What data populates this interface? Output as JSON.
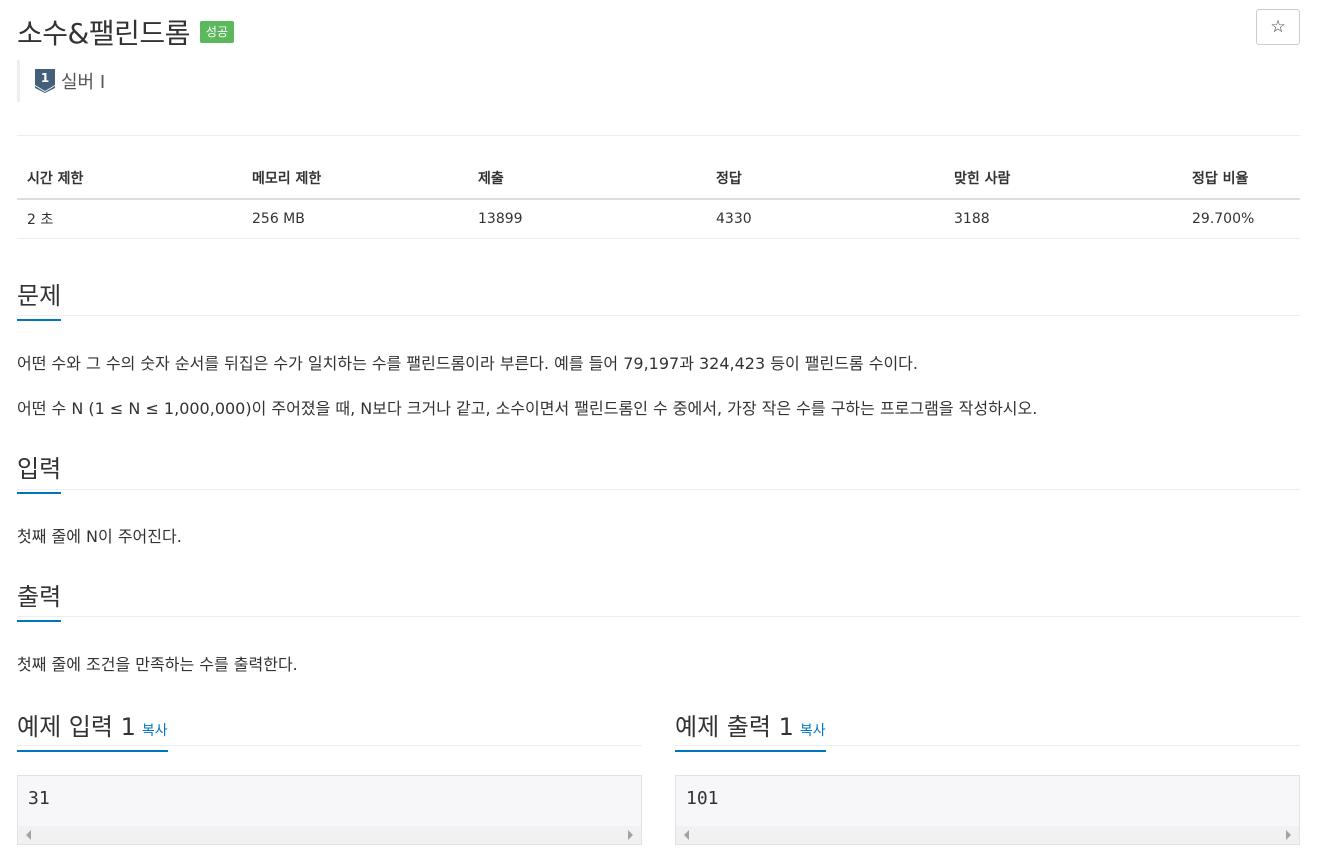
{
  "problem": {
    "title": "소수&팰린드롬",
    "result_badge": "성공",
    "star_icon": "☆",
    "tier": {
      "icon": "silver-1-icon",
      "number": "1",
      "label": "실버 I"
    }
  },
  "info_table": {
    "headers": [
      "시간 제한",
      "메모리 제한",
      "제출",
      "정답",
      "맞힌 사람",
      "정답 비율"
    ],
    "values": [
      "2 초",
      "256 MB",
      "13899",
      "4330",
      "3188",
      "29.700%"
    ]
  },
  "sections": {
    "problem": {
      "title": "문제",
      "paragraphs": [
        "어떤 수와 그 수의 숫자 순서를 뒤집은 수가 일치하는 수를 팰린드롬이라 부른다. 예를 들어 79,197과 324,423 등이 팰린드롬 수이다.",
        "어떤 수 N (1 ≤ N ≤ 1,000,000)이 주어졌을 때, N보다 크거나 같고, 소수이면서 팰린드롬인 수 중에서, 가장 작은 수를 구하는 프로그램을 작성하시오."
      ]
    },
    "input": {
      "title": "입력",
      "text": "첫째 줄에 N이 주어진다."
    },
    "output": {
      "title": "출력",
      "text": "첫째 줄에 조건을 만족하는 수를 출력한다."
    }
  },
  "samples": {
    "input": {
      "title": "예제 입력 1",
      "copy": "복사",
      "value": "31"
    },
    "output": {
      "title": "예제 출력 1",
      "copy": "복사",
      "value": "101"
    }
  },
  "colors": {
    "accent": "#0076c0",
    "success": "#5cb85c",
    "tier_silver": "#435f7a"
  }
}
